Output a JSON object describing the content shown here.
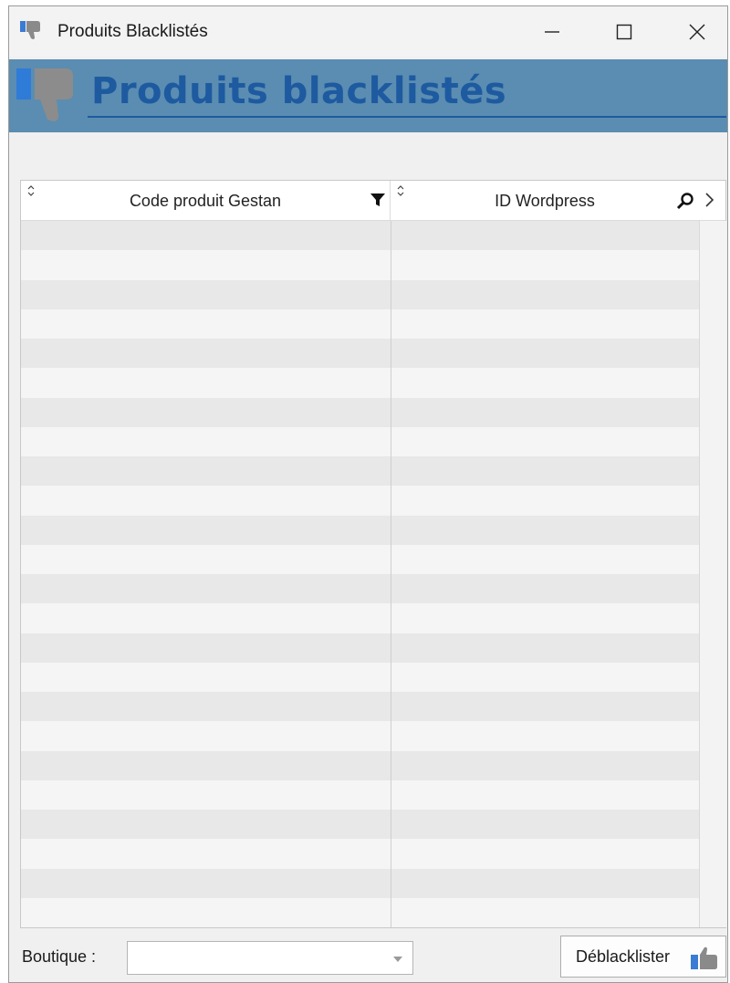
{
  "window": {
    "title": "Produits Blacklistés",
    "minimize_icon": "minimize-icon",
    "maximize_icon": "maximize-icon",
    "close_icon": "close-icon"
  },
  "banner": {
    "title": "Produits blacklistés",
    "icon": "thumbs-down-icon"
  },
  "grid": {
    "columns": [
      {
        "label": "Code produit Gestan",
        "icons": [
          "sort-icon",
          "filter-icon"
        ]
      },
      {
        "label": "ID Wordpress",
        "icons": [
          "sort-icon",
          "search-icon"
        ]
      }
    ],
    "rows": [
      [
        "",
        ""
      ],
      [
        "",
        ""
      ],
      [
        "",
        ""
      ],
      [
        "",
        ""
      ],
      [
        "",
        ""
      ],
      [
        "",
        ""
      ],
      [
        "",
        ""
      ],
      [
        "",
        ""
      ],
      [
        "",
        ""
      ],
      [
        "",
        ""
      ],
      [
        "",
        ""
      ],
      [
        "",
        ""
      ],
      [
        "",
        ""
      ],
      [
        "",
        ""
      ],
      [
        "",
        ""
      ],
      [
        "",
        ""
      ],
      [
        "",
        ""
      ],
      [
        "",
        ""
      ],
      [
        "",
        ""
      ],
      [
        "",
        ""
      ],
      [
        "",
        ""
      ],
      [
        "",
        ""
      ],
      [
        "",
        ""
      ],
      [
        "",
        ""
      ]
    ]
  },
  "footer": {
    "shop_label": "Boutique :",
    "shop_value": "",
    "unblacklist_label": "Déblacklister",
    "unblacklist_icon": "thumbs-up-icon"
  },
  "colors": {
    "banner_bg": "#5a8db1",
    "banner_title": "#1e5aa0",
    "row_odd": "#e8e8e8",
    "row_even": "#f5f5f5"
  }
}
